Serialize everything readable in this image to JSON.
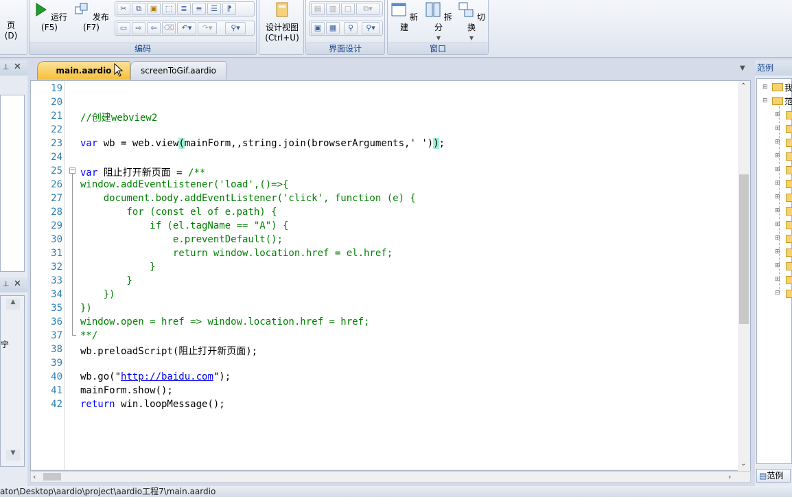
{
  "ribbon": {
    "left_partial_label": "页(D)",
    "run_label": "运行(F5)",
    "publish_label": "发布(F7)",
    "coding_group_label": "编码",
    "design_view_label_1": "设计视图",
    "design_view_label_2": "(Ctrl+U)",
    "ui_design_group_label": "界面设计",
    "new_label": "新建",
    "split_label": "拆分",
    "switch_label": "切换",
    "window_group_label": "窗口"
  },
  "tabs": [
    {
      "label": "main.aardio",
      "active": true
    },
    {
      "label": "screenToGif.aardio",
      "active": false
    }
  ],
  "right_panel": {
    "title": "范例",
    "bottom_tab": "范例",
    "tree_partial_1": "我",
    "tree_partial_2": "范"
  },
  "left_panel": {
    "partial_char_1": "宁"
  },
  "code": {
    "lines": [
      {
        "n": "19",
        "t": ""
      },
      {
        "n": "20",
        "t": ""
      },
      {
        "n": "21",
        "t": "//创建webview2"
      },
      {
        "n": "22",
        "t": ""
      },
      {
        "n": "23",
        "t": "var wb = web.view(mainForm,,string.join(browserArguments,' '));"
      },
      {
        "n": "24",
        "t": ""
      },
      {
        "n": "25",
        "t": "var 阻止打开新页面 = /**"
      },
      {
        "n": "26",
        "t": "window.addEventListener('load',()=>{"
      },
      {
        "n": "27",
        "t": "    document.body.addEventListener('click', function (e) {"
      },
      {
        "n": "28",
        "t": "        for (const el of e.path) {"
      },
      {
        "n": "29",
        "t": "            if (el.tagName == \"A\") {"
      },
      {
        "n": "30",
        "t": "                e.preventDefault();"
      },
      {
        "n": "31",
        "t": "                return window.location.href = el.href;"
      },
      {
        "n": "32",
        "t": "            }"
      },
      {
        "n": "33",
        "t": "        }"
      },
      {
        "n": "34",
        "t": "    })"
      },
      {
        "n": "35",
        "t": "})"
      },
      {
        "n": "36",
        "t": "window.open = href => window.location.href = href;"
      },
      {
        "n": "37",
        "t": "**/"
      },
      {
        "n": "38",
        "t": "wb.preloadScript(阻止打开新页面);"
      },
      {
        "n": "39",
        "t": ""
      },
      {
        "n": "40",
        "t": "wb.go(\"http://baidu.com\");"
      },
      {
        "n": "41",
        "t": "mainForm.show();"
      },
      {
        "n": "42",
        "t": "return win.loopMessage();"
      }
    ],
    "parts": {
      "l21": "//创建webview2",
      "l23_kw": "var",
      "l23_a": " wb = web.view",
      "l23_po": "(",
      "l23_b": "mainForm,,string.join(browserArguments,' ')",
      "l23_pc": ")",
      "l23_end": ";",
      "l25_kw": "var",
      "l25_rest": " 阻止打开新页面 = ",
      "l25_cm": "/**",
      "l38": "wb.preloadScript(阻止打开新页面);",
      "l40_a": "wb.go(\"",
      "l40_link": "http://baidu.com",
      "l40_b": "\");",
      "l41": "mainForm.show();",
      "l42_kw": "return",
      "l42_rest": " win.loopMessage();"
    }
  },
  "status": {
    "path": "ator\\Desktop\\aardio\\project\\aardio工程7\\main.aardio"
  },
  "colors": {
    "keyword": "#0000ff",
    "comment_string": "#008000",
    "line_number": "#2b7fb0",
    "bracket_highlight": "#9ff0d9",
    "active_tab": "#f9c94e"
  }
}
